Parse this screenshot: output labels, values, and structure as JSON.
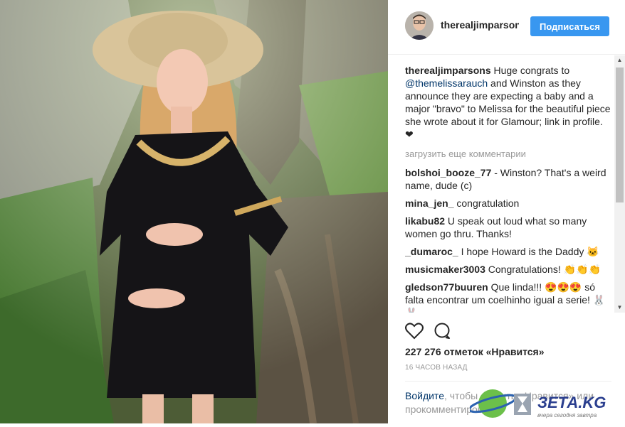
{
  "post": {
    "username": "therealjimparsons",
    "follow_label": "Подписаться",
    "caption": {
      "author": "therealjimparsons",
      "text_before": " Huge congrats to ",
      "mention": "@themelissarauch",
      "text_after": " and Winston as they announce they are expecting a baby and a major \"bravo\" to Melissa for the beautiful piece she wrote about it for Glamour; link in profile. ❤"
    },
    "load_more": "загрузить еще комментарии",
    "comments": [
      {
        "author": "bolshoi_booze_77",
        "text": " - Winston? That's a weird name, dude (c)"
      },
      {
        "author": "mina_jen_",
        "text": " congratulation"
      },
      {
        "author": "likabu82",
        "text": " U speak out loud what so many women go thru. Thanks!"
      },
      {
        "author": "_dumaroc_",
        "text": " I hope Howard is the Daddy 🐱"
      },
      {
        "author": "musicmaker3003",
        "text": " Congratulations! 👏👏👏"
      },
      {
        "author": "gledson77buuren",
        "text": " Que linda!!! 😍😍😍 só falta encontrar um coelhinho igual a serie! 🐰🐰"
      }
    ],
    "likes": "227 276 отметок «Нравится»",
    "time": "16 ЧАСОВ НАЗАД",
    "login": {
      "link": "Войдите",
      "text": ", чтобы ставить «Нравится» или прокомментировать."
    }
  },
  "icons": {
    "like": "heart-icon",
    "comment": "comment-bubble-icon"
  },
  "watermark": {
    "brand": "ЗЕТА.KG",
    "tagline": "вчера сегодня завтра"
  },
  "colors": {
    "accent": "#3897f0",
    "link": "#003569",
    "muted": "#999999"
  }
}
